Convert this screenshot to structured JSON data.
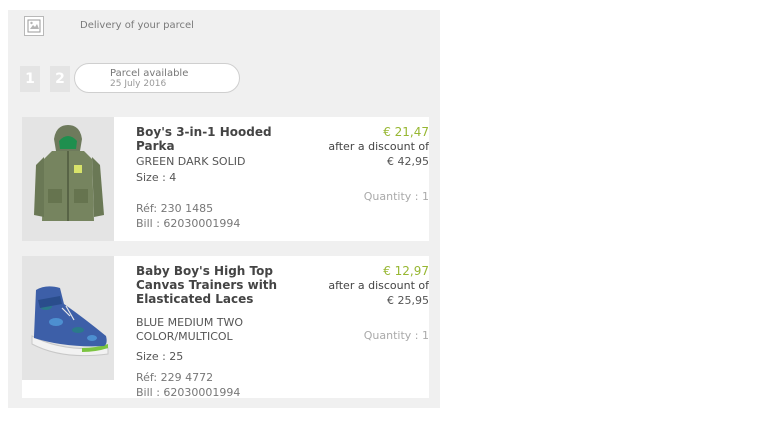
{
  "header": {
    "title": "Delivery of your parcel",
    "logo_icon": "broken-image-icon"
  },
  "steps": [
    "1",
    "2"
  ],
  "status": {
    "label": "Parcel available",
    "date": "25 July 2016"
  },
  "colors": {
    "price": "#97b732",
    "panel": "#f0f0f0"
  },
  "products": [
    {
      "name": "Boy's 3-in-1 Hooded Parka",
      "color": "GREEN DARK SOLID",
      "size": "Size : 4",
      "price": "€ 21,47",
      "discount_label": "after a discount of",
      "old_price": "€ 42,95",
      "quantity": "Quantity : 1",
      "ref": "Réf: 230 1485",
      "bill": "Bill : 62030001994",
      "icon": "parka-jacket-image"
    },
    {
      "name": "Baby Boy's High Top Canvas Trainers with Elasticated Laces",
      "color": "BLUE MEDIUM TWO COLOR/MULTICOL",
      "size": "Size : 25",
      "price": "€ 12,97",
      "discount_label": "after a discount of",
      "old_price": "€ 25,95",
      "quantity": "Quantity : 1",
      "ref": "Réf: 229 4772",
      "bill": "Bill : 62030001994",
      "icon": "sneaker-image"
    }
  ]
}
